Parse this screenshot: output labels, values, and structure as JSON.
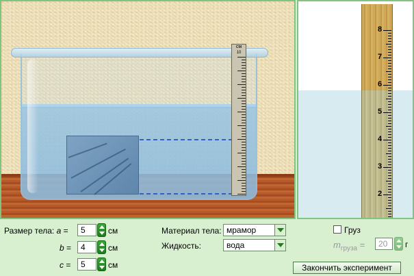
{
  "scene": {
    "scale_unit": "см",
    "scale_top": "10",
    "scale_ticks": 10
  },
  "zoom": {
    "ruler_labels": [
      "8",
      "7",
      "6",
      "5",
      "4",
      "3",
      "2"
    ]
  },
  "controls": {
    "size_label": "Размер тела:",
    "a_var": "a",
    "b_var": "b",
    "c_var": "c",
    "equals": "=",
    "a_value": "5",
    "b_value": "4",
    "c_value": "5",
    "unit_cm": "см",
    "material_label": "Материал тела:",
    "material_value": "мрамор",
    "liquid_label": "Жидкость:",
    "liquid_value": "вода",
    "load_label": "Груз",
    "load_checked": false,
    "mass_var": "m",
    "mass_sub": "груза",
    "mass_value": "20",
    "mass_unit": "г",
    "finish_button": "Закончить эксперимент"
  },
  "colors": {
    "panel_border": "#7fc47f",
    "accent_green": "#1e7d1e",
    "water": "#7fb6de",
    "block": "#6e94b8"
  }
}
